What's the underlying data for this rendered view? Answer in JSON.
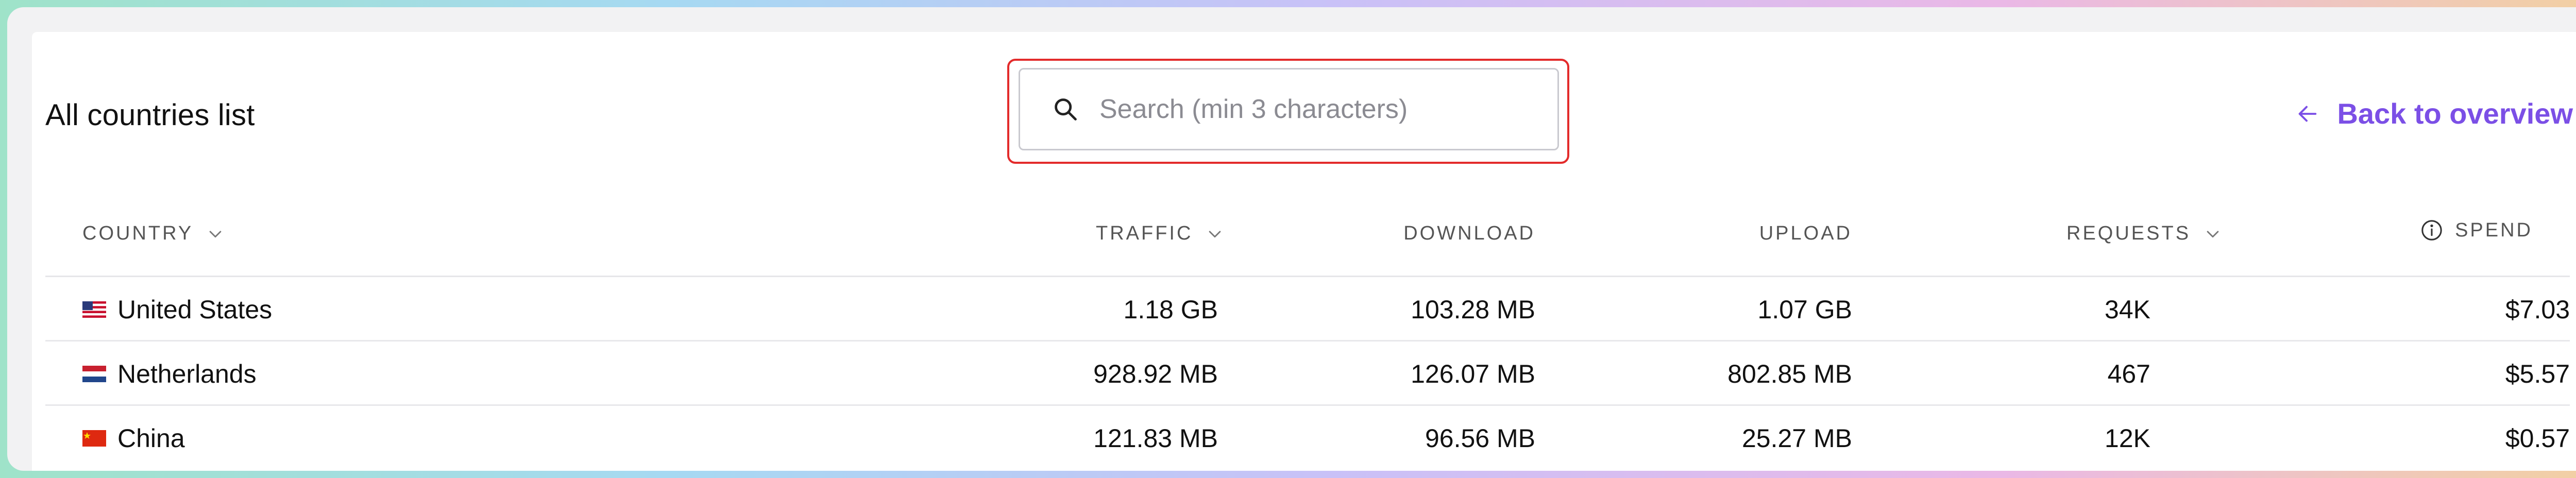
{
  "page": {
    "title": "All countries list",
    "back_label": "Back to overview"
  },
  "search": {
    "placeholder": "Search (min 3 characters)",
    "value": ""
  },
  "table": {
    "columns": [
      "COUNTRY",
      "TRAFFIC",
      "DOWNLOAD",
      "UPLOAD",
      "REQUESTS",
      "SPEND"
    ],
    "rows": [
      {
        "country": "United States",
        "traffic": "1.18 GB",
        "download": "103.28 MB",
        "upload": "1.07 GB",
        "requests": "34K",
        "spend": "$7.03"
      },
      {
        "country": "Netherlands",
        "traffic": "928.92 MB",
        "download": "126.07 MB",
        "upload": "802.85 MB",
        "requests": "467",
        "spend": "$5.57"
      },
      {
        "country": "China",
        "traffic": "121.83 MB",
        "download": "96.56 MB",
        "upload": "25.27 MB",
        "requests": "12K",
        "spend": "$0.57"
      }
    ]
  },
  "colors": {
    "accent": "#7b4fe6",
    "focus_ring": "#e32b2b",
    "divider": "#e6e6e9"
  },
  "icons": [
    "search-icon",
    "arrow-left-icon",
    "chevron-down-icon",
    "info-icon",
    "flag-us-icon",
    "flag-nl-icon",
    "flag-cn-icon"
  ]
}
